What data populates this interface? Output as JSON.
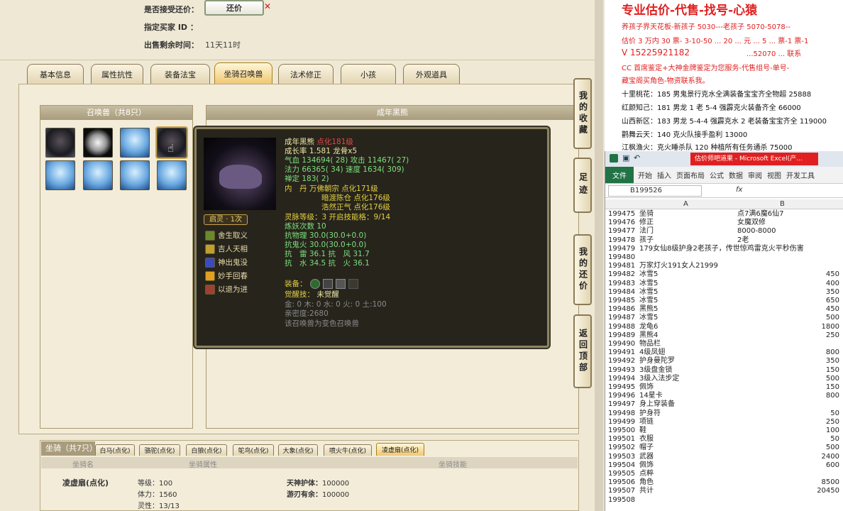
{
  "top": {
    "accept_label": "是否接受还价：",
    "accept_btn": "还价",
    "buyer_label": "指定买家 ID ：",
    "remain_label": "出售剩余时间：",
    "remain_value": "11天11时"
  },
  "tabs": [
    "基本信息",
    "属性抗性",
    "装备法宝",
    "坐骑召唤兽",
    "法术修正",
    "小孩",
    "外观道具"
  ],
  "side_buttons": [
    "我的收藏",
    "足迹",
    "我的还价",
    "返回顶部"
  ],
  "pets_header": "召唤兽（共8只）",
  "pet_panel_title": "成年黑熊",
  "popup": {
    "name": "成年黑熊",
    "name_suffix": "点化181级",
    "l2": "成长率 1.581 龙骨x5",
    "l3": "气血 134694( 28) 攻击 11467( 27)",
    "l4": "法力 66365( 34) 速度 1634( 309)",
    "l5": "禅定 183( 2)",
    "l6": "内　丹 万佛朝宗 点化171级",
    "l7": "暗渡陈仓 点化176级",
    "l8": "浩然正气 点化176级",
    "l9": "灵脉等级：3 开启技能格：9/14",
    "l10": "炼妖次数 10",
    "l11": "抗物理 30.0(30.0+0.0)",
    "l12": "抗鬼火 30.0(30.0+0.0)",
    "l13": "抗　雷 36.1 抗　风 31.7",
    "l14": "抗　水 34.5 抗　火 36.1",
    "equip": "装备：",
    "awaken_label": "觉醒技：",
    "awaken_value": "未觉醒",
    "l17": "金: 0 木: 0 水: 0 火: 0 土:100",
    "l18": "亲密度:2680",
    "l19": "该召唤兽为变色召唤兽",
    "lingxi": "启灵 · 1次",
    "skills": [
      "舍生取义",
      "吉人天相",
      "神出鬼没",
      "妙手回春",
      "以退为进"
    ]
  },
  "mount": {
    "header": "坐骑（共7只）",
    "tabs": [
      "白马(点化)",
      "骆驼(点化)",
      "白狼(点化)",
      "鸵鸟(点化)",
      "大象(点化)",
      "喷火牛(点化)",
      "凌虚扇(点化)"
    ],
    "col1": "坐骑名",
    "col2": "坐骑属性",
    "col3": "坐骑技能",
    "name": "凌虚扇(点化)",
    "lv": "等级：100",
    "tili": "体力：1560",
    "lingxing": "灵性：13/13",
    "skill1_name": "天神护体：",
    "skill1_val": "100000",
    "skill2_name": "游刃有余：",
    "skill2_val": "100000"
  },
  "note": {
    "title": "专业估价-代售-找号-心猿",
    "l1": "养孩子界天花板-新孩子 5030---老孩子 5070-5078--",
    "l2": "估价 3 万内 30 票- 3-10-50 ... 20 ... 元 ... 5 ... 票-1 票-1",
    "l3": "V 15225921182",
    "l3b": "...52070 ... 联系",
    "l4": "CC 首席鉴定+大神金牌鉴定为您服务-代售组号-单号-",
    "l5": "藏宝阁买角色-物资联系我。",
    "l6": "十里桃花：185 男鬼景行克水全满装备宝宝齐全物超 25888",
    "l7": "红颜知己：181 男龙 1 老 5-4 强霹克火装备齐全 66000",
    "l8": "山西新区：183 男龙 5-4-4 强霹克水 2 老装备宝宝齐全 119000",
    "l9": "鹳舞云天：140 克火队接手盈利 13000",
    "l10": "江枫渔火：克火睡杀队 120 种植所有任务通杀 75000"
  },
  "excel": {
    "title": "估价师吧道果 - Microsoft Excel(产...",
    "ribbon": [
      "文件",
      "开始",
      "插入",
      "页面布局",
      "公式",
      "数据",
      "审阅",
      "视图",
      "开发工具"
    ],
    "namebox": "B199526",
    "fx": "fx",
    "col_a": "A",
    "col_b": "B",
    "rows": [
      [
        "199475",
        "坐骑",
        "点7满6魔6仙7",
        ""
      ],
      [
        "199476",
        "修正",
        "女魔双修",
        ""
      ],
      [
        "199477",
        "法门",
        "8000-8000",
        ""
      ],
      [
        "199478",
        "孩子",
        "2老",
        ""
      ],
      [
        "199479",
        "179女仙8级护身2老孩子，传世惊鸡雷克火平秒伤害",
        "",
        ""
      ],
      [
        "199480",
        "",
        "",
        ""
      ],
      [
        "199481",
        "万家灯火191女人21999",
        "",
        ""
      ],
      [
        "199482",
        "冰雪5",
        "",
        "450"
      ],
      [
        "199483",
        "冰雪5",
        "",
        "400"
      ],
      [
        "199484",
        "冰雪5",
        "",
        "350"
      ],
      [
        "199485",
        "冰雪5",
        "",
        "650"
      ],
      [
        "199486",
        "黑熊5",
        "",
        "450"
      ],
      [
        "199487",
        "冰雪5",
        "",
        "500"
      ],
      [
        "199488",
        "龙龟6",
        "",
        "1800"
      ],
      [
        "199489",
        "黑熊4",
        "",
        "250"
      ],
      [
        "199490",
        "物品栏",
        "",
        ""
      ],
      [
        "199491",
        "4级凤翅",
        "",
        "800"
      ],
      [
        "199492",
        "护身曼陀罗",
        "",
        "350"
      ],
      [
        "199493",
        "3级盘金锁",
        "",
        "150"
      ],
      [
        "199494",
        "3级入法步定",
        "",
        "500"
      ],
      [
        "199495",
        "佩饰",
        "",
        "150"
      ],
      [
        "199496",
        "14星卡",
        "",
        "800"
      ],
      [
        "199497",
        "身上穿装备",
        "",
        ""
      ],
      [
        "199498",
        "护身符",
        "",
        "50"
      ],
      [
        "199499",
        "项链",
        "",
        "250"
      ],
      [
        "199500",
        "鞋",
        "",
        "100"
      ],
      [
        "199501",
        "衣服",
        "",
        "50"
      ],
      [
        "199502",
        "帽子",
        "",
        "500"
      ],
      [
        "199503",
        "武器",
        "",
        "2400"
      ],
      [
        "199504",
        "佩饰",
        "",
        "600"
      ],
      [
        "199505",
        "点粹",
        "",
        ""
      ],
      [
        "199506",
        "角色",
        "",
        "8500"
      ],
      [
        "199507",
        "共计",
        "",
        "20450"
      ],
      [
        "199508",
        "",
        "",
        ""
      ]
    ]
  },
  "colors": {
    "note_red": "#e02020",
    "excel_green": "#217346",
    "gold": "#d9a53a"
  }
}
